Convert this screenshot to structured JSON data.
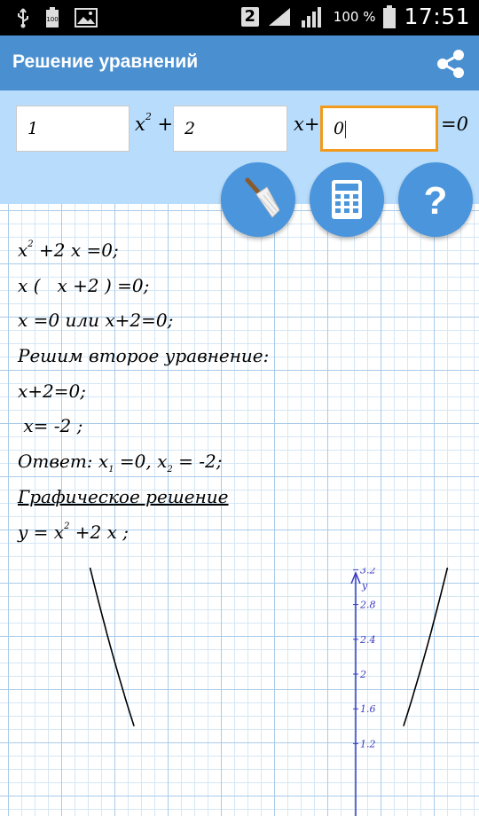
{
  "status_bar": {
    "battery_level": "100",
    "sim": "2",
    "battery_percent": "100 %",
    "time": "17:51",
    "icons": [
      "usb-icon",
      "battery-small-icon",
      "image-icon",
      "sim-icon",
      "wifi-icon",
      "signal-icon",
      "battery-icon"
    ]
  },
  "app_bar": {
    "title": "Решение уравнений",
    "share_icon": "share-icon"
  },
  "equation": {
    "a": "1",
    "b": "2",
    "c": "0",
    "x2": "x",
    "x2_exp": "2",
    "plus1": "+",
    "x1": "x+",
    "equals": "=0"
  },
  "buttons": {
    "clear_icon": "broom-icon",
    "calc_icon": "calculator-icon",
    "help_icon": "question-icon",
    "help_label": "?"
  },
  "solution": {
    "line1_pre": "x",
    "line1_exp": "2",
    "line1_post": " +2 x =0;",
    "line2": "x (   x +2 ) =0;",
    "line3": "x =0 или x+2=0;",
    "line4": "Решим второе уравнение:",
    "line5": "x+2=0;",
    "line6": " x= -2 ;",
    "answer_pre": "Ответ: x",
    "answer_sub1": "1",
    "answer_mid": " =0, x",
    "answer_sub2": "2",
    "answer_post": " = -2;",
    "graph_heading": "Графическое решение",
    "func_pre": "y = x",
    "func_exp": "2",
    "func_post": " +2 x ;"
  },
  "chart_data": {
    "type": "line",
    "ylabel": "y",
    "y_ticks": [
      "3.2",
      "2.8",
      "2.4",
      "2",
      "1.6",
      "1.2"
    ],
    "series": [
      {
        "name": "",
        "function": "y = x^2 + 2x"
      }
    ],
    "axis_color": "#3a3ac0",
    "curve_color": "#000000"
  },
  "colors": {
    "app_bar": "#4a8fd0",
    "panel": "#b8dcfb",
    "button": "#4a95dc",
    "active_border": "#f29a1c"
  }
}
